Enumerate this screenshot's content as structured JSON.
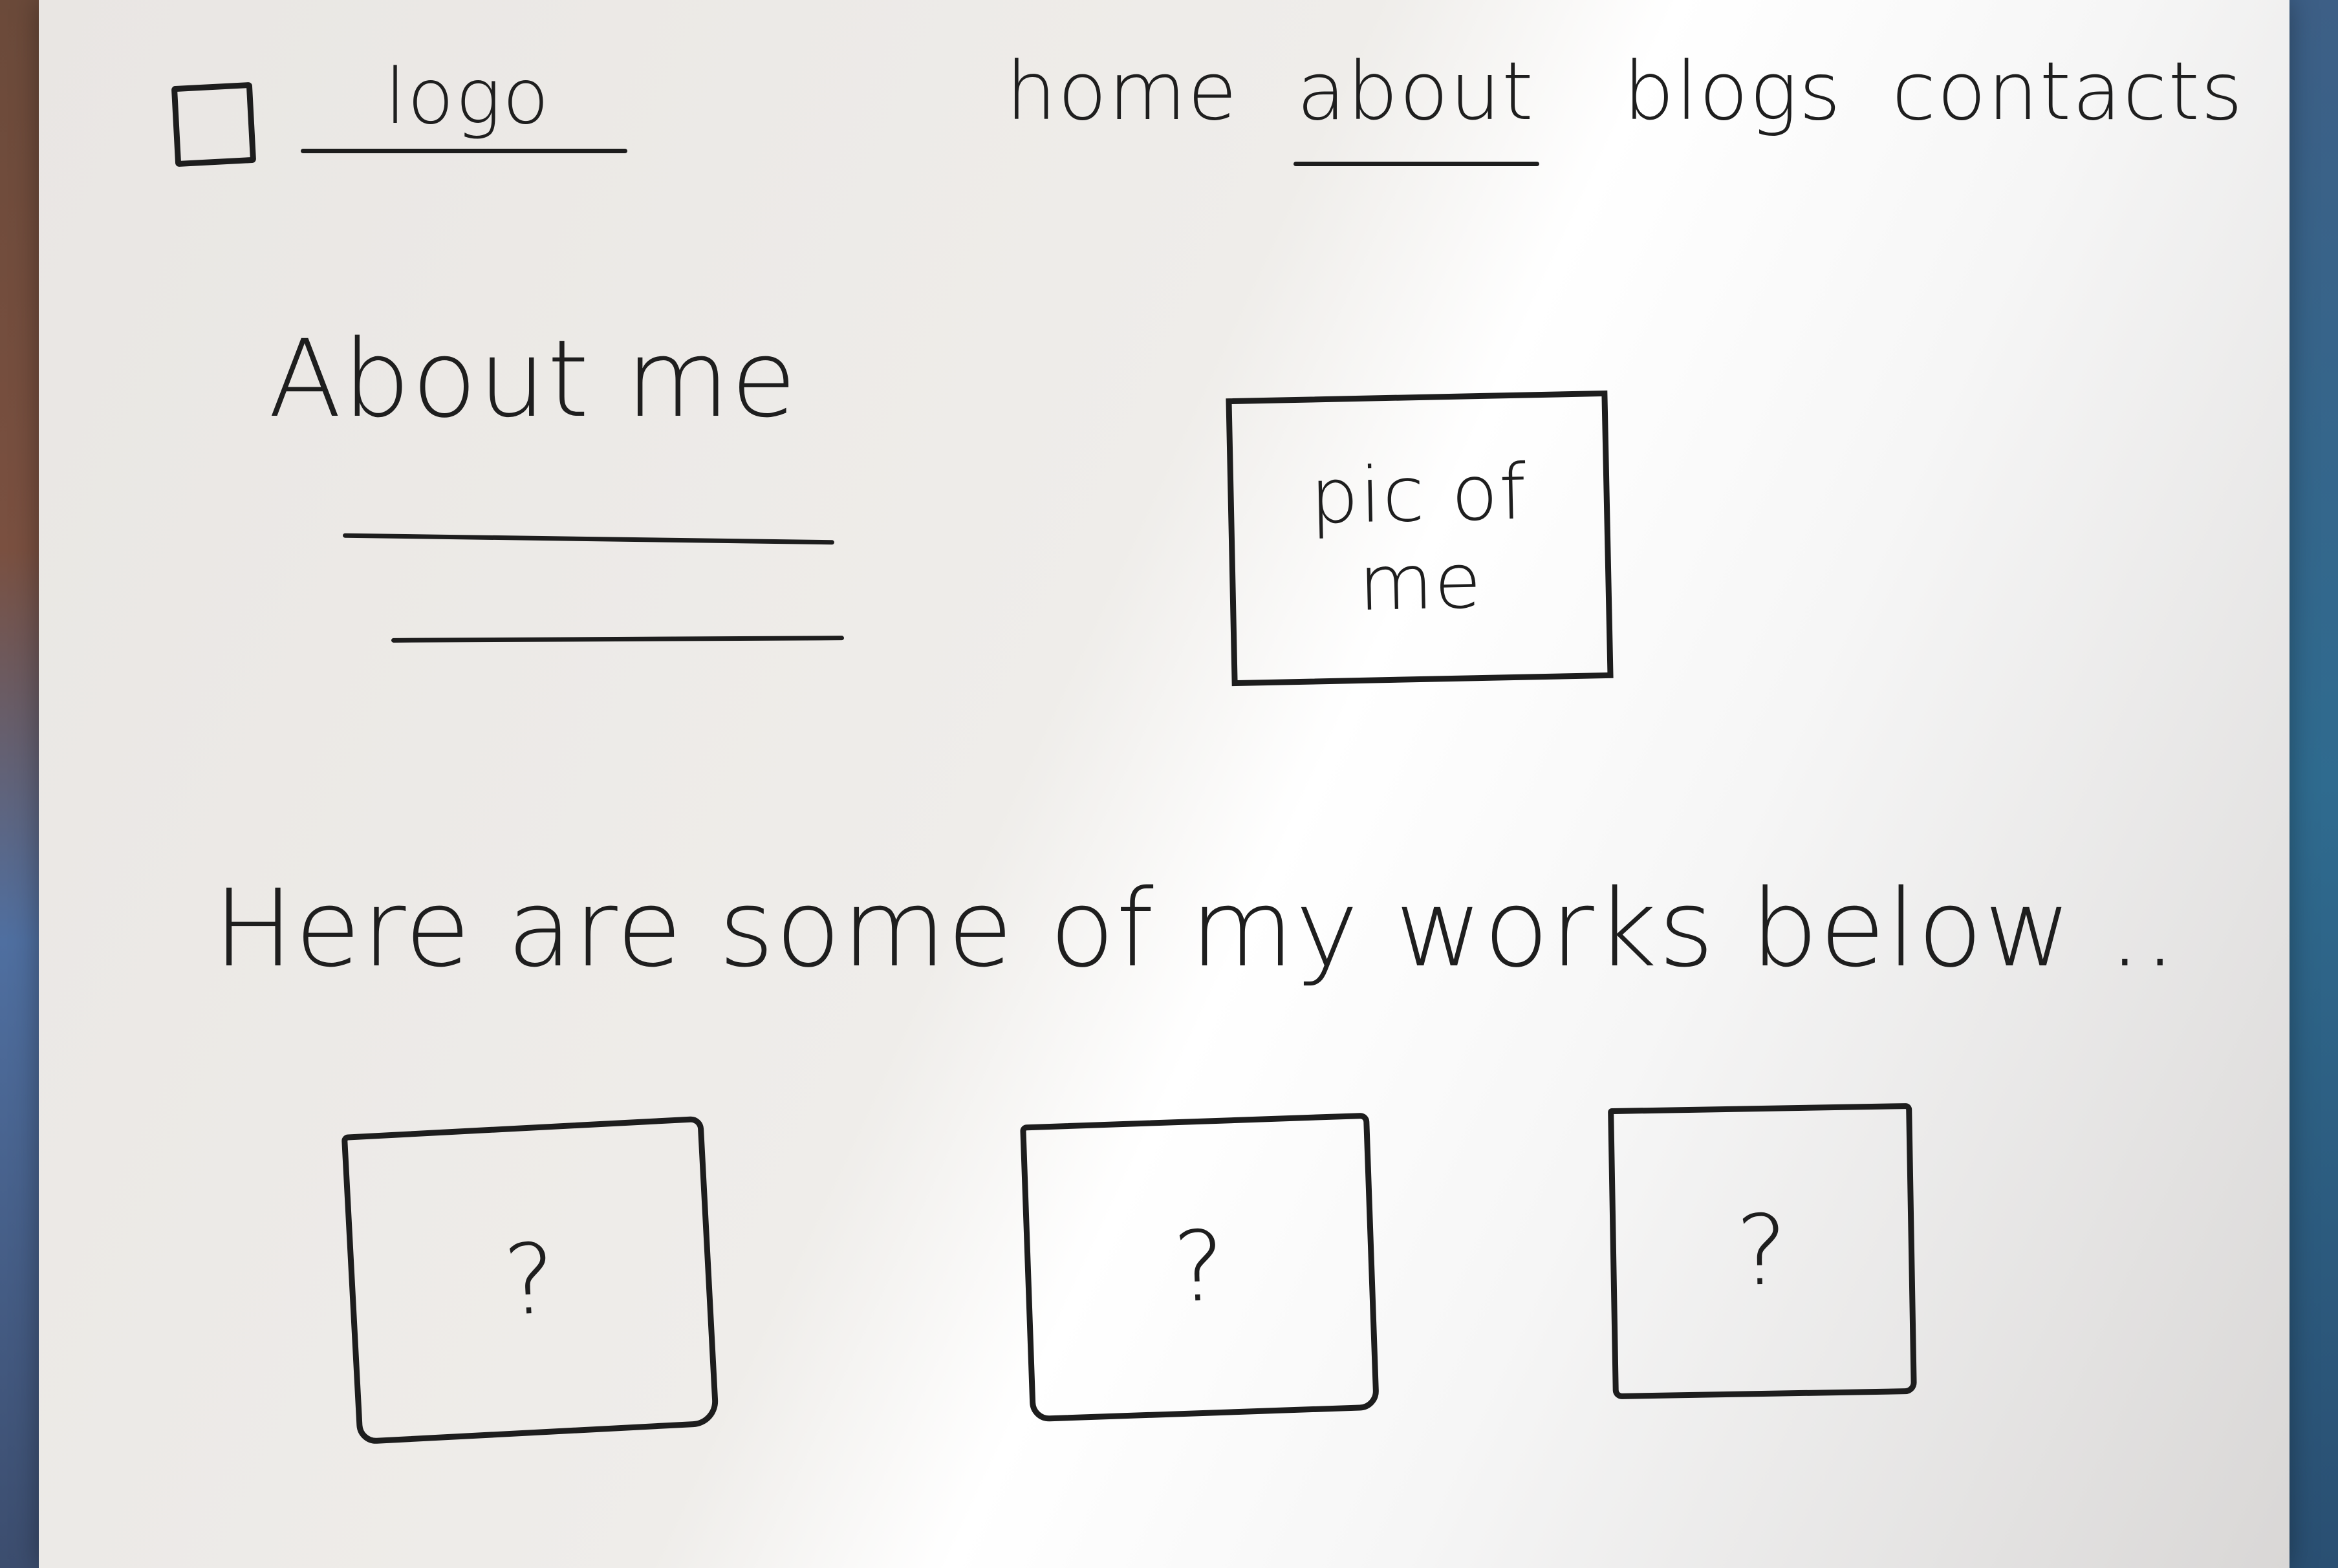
{
  "header": {
    "menu_icon": "square-menu-icon",
    "logo_label": "logo",
    "nav": [
      {
        "label": "home"
      },
      {
        "label": "about",
        "active": true
      },
      {
        "label": "blogs"
      },
      {
        "label": "contacts"
      }
    ]
  },
  "about": {
    "title": "About me",
    "photo_label": "pic of me"
  },
  "works": {
    "heading": "Here are some of my works below ..",
    "cards": [
      {
        "mark": "?"
      },
      {
        "mark": "?"
      },
      {
        "mark": "?"
      }
    ]
  },
  "colors": {
    "ink": "#1d1d1d",
    "paper": "#efedea"
  }
}
